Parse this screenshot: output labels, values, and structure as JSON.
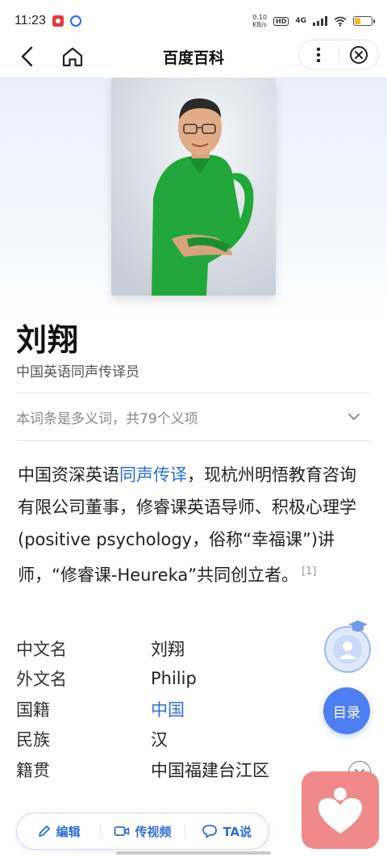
{
  "status_bar": {
    "time": "11:23",
    "net_speed_value": "0.10",
    "net_speed_unit": "KB/s",
    "hd_label": "HD",
    "network_label": "4G",
    "battery_level": 0.35
  },
  "nav": {
    "title": "百度百科",
    "back_icon": "chevron-left-icon",
    "home_icon": "home-icon",
    "more_icon": "more-vertical-icon",
    "close_icon": "close-circle-icon"
  },
  "entry": {
    "title": "刘翔",
    "subtitle": "中国英语同声传译员",
    "polysemy_note": "本词条是多义词，共79个义项",
    "summary": {
      "part1": "中国资深英语",
      "link": "同声传译",
      "part2": "，现杭州明悟教育咨询有限公司董事，修睿课英语导师、积极心理学(positive psychology，俗称“幸福课”)讲师，“修睿课-Heureka”共同创立者。",
      "ref": "[1]"
    }
  },
  "infobox": [
    {
      "key": "中文名",
      "value": "刘翔"
    },
    {
      "key": "外文名",
      "value": "Philip"
    },
    {
      "key": "国籍",
      "value": "中国",
      "link": true
    },
    {
      "key": "民族",
      "value": "汉"
    },
    {
      "key": "籍贯",
      "value": "中国福建台江区"
    }
  ],
  "floating": {
    "toc_label": "目录"
  },
  "bottom_bar": {
    "edit_label": "编辑",
    "video_label": "传视频",
    "ta_label": "TA说"
  },
  "colors": {
    "accent": "#2b6fd6",
    "toc_button": "#4e7ff0",
    "heart_fab": "#f08a8a",
    "shirt": "#22a83a"
  }
}
